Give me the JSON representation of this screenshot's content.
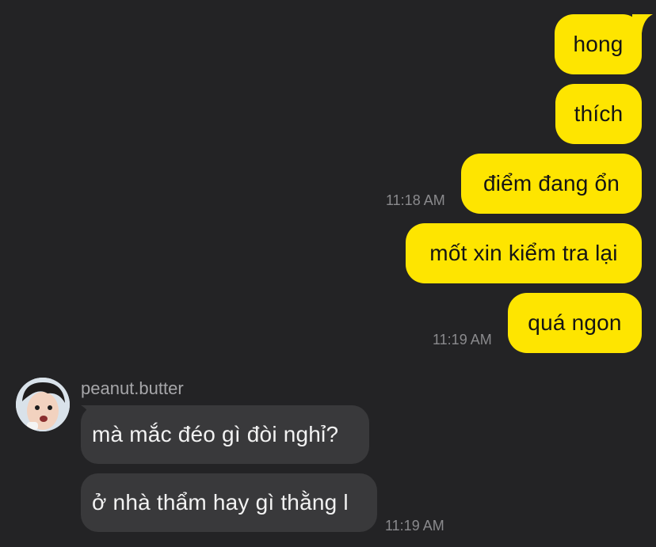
{
  "messages_out": [
    {
      "text": "hong"
    },
    {
      "text": "thích"
    },
    {
      "text": "điểm đang ổn",
      "time": "11:18 AM"
    },
    {
      "text": "mốt xin kiểm tra lại"
    },
    {
      "text": "quá ngon",
      "time": "11:19 AM"
    }
  ],
  "incoming": {
    "sender": "peanut.butter",
    "avatar_icon": "user-avatar-photo",
    "messages": [
      {
        "text": "mà mắc đéo gì đòi nghỉ?"
      },
      {
        "text": "ở nhà thẩm hay gì thằng l",
        "time": "11:19 AM"
      }
    ]
  },
  "colors": {
    "background": "#232325",
    "outgoing_bubble": "#fee500",
    "incoming_bubble": "#39393b",
    "timestamp": "#8a8a8d"
  }
}
